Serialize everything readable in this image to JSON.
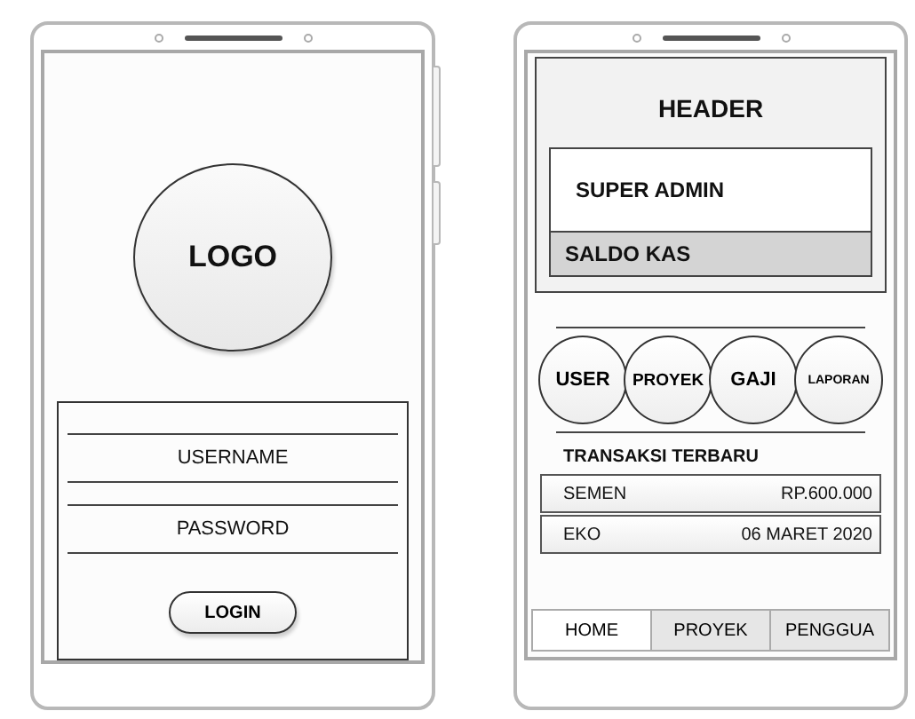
{
  "login_screen": {
    "logo": "LOGO",
    "fields": [
      {
        "placeholder": "USERNAME"
      },
      {
        "placeholder": "PASSWORD"
      }
    ],
    "button": "LOGIN"
  },
  "home_screen": {
    "header": "HEADER",
    "user_role": "SUPER ADMIN",
    "balance_label": "SALDO KAS",
    "menu": [
      {
        "label": "USER"
      },
      {
        "label": "PROYEK"
      },
      {
        "label": "GAJI"
      },
      {
        "label": "LAPORAN"
      }
    ],
    "section_title": "TRANSAKSI TERBARU",
    "transactions": [
      {
        "name": "SEMEN",
        "detail": "RP.600.000"
      },
      {
        "name": "EKO",
        "detail": "06 MARET 2020"
      }
    ],
    "tabs": [
      {
        "label": "HOME",
        "selected": true
      },
      {
        "label": "PROYEK",
        "selected": false
      },
      {
        "label": "PENGGUA",
        "selected": false
      }
    ]
  }
}
